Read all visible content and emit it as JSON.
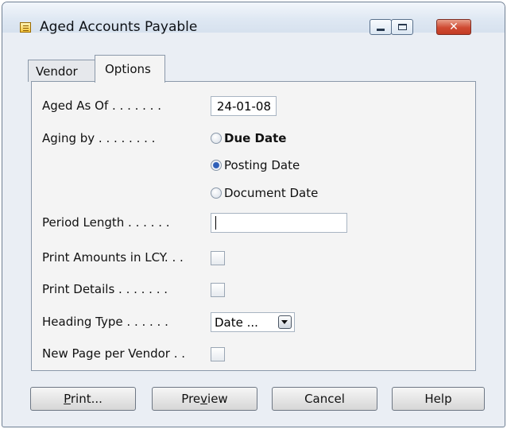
{
  "window": {
    "title": "Aged Accounts Payable",
    "controls": {
      "minimize": "minimize",
      "maximize": "maximize",
      "close": "✕"
    }
  },
  "tabs": [
    {
      "label": "Vendor",
      "active": false
    },
    {
      "label": "Options",
      "active": true
    }
  ],
  "options": {
    "aged_as_of": {
      "label": "Aged As Of . . . . . . .",
      "value": "24-01-08"
    },
    "aging_by": {
      "label": "Aging by . . . . . . . .",
      "options": [
        {
          "label": "Due Date",
          "checked": false
        },
        {
          "label": "Posting Date",
          "checked": true
        },
        {
          "label": "Document Date",
          "checked": false
        }
      ]
    },
    "period_length": {
      "label": "Period Length . . . . . .",
      "value": ""
    },
    "print_amounts_in_lcy": {
      "label": "Print Amounts in LCY. . .",
      "checked": false
    },
    "print_details": {
      "label": "Print Details . . . . . . .",
      "checked": false
    },
    "heading_type": {
      "label": "Heading Type . . . . . .",
      "value": "Date ..."
    },
    "new_page_per_vendor": {
      "label": "New Page per Vendor . .",
      "checked": false
    }
  },
  "buttons": {
    "print": {
      "mnemonic": "P",
      "rest": "rint..."
    },
    "preview": {
      "before": "Pre",
      "mnemonic": "v",
      "after": "iew"
    },
    "cancel": "Cancel",
    "help": "Help"
  },
  "colors": {
    "accent": "#2e5fb8",
    "close_button": "#c33c24",
    "panel": "#f4f4f4",
    "frame": "#eaeef4"
  }
}
